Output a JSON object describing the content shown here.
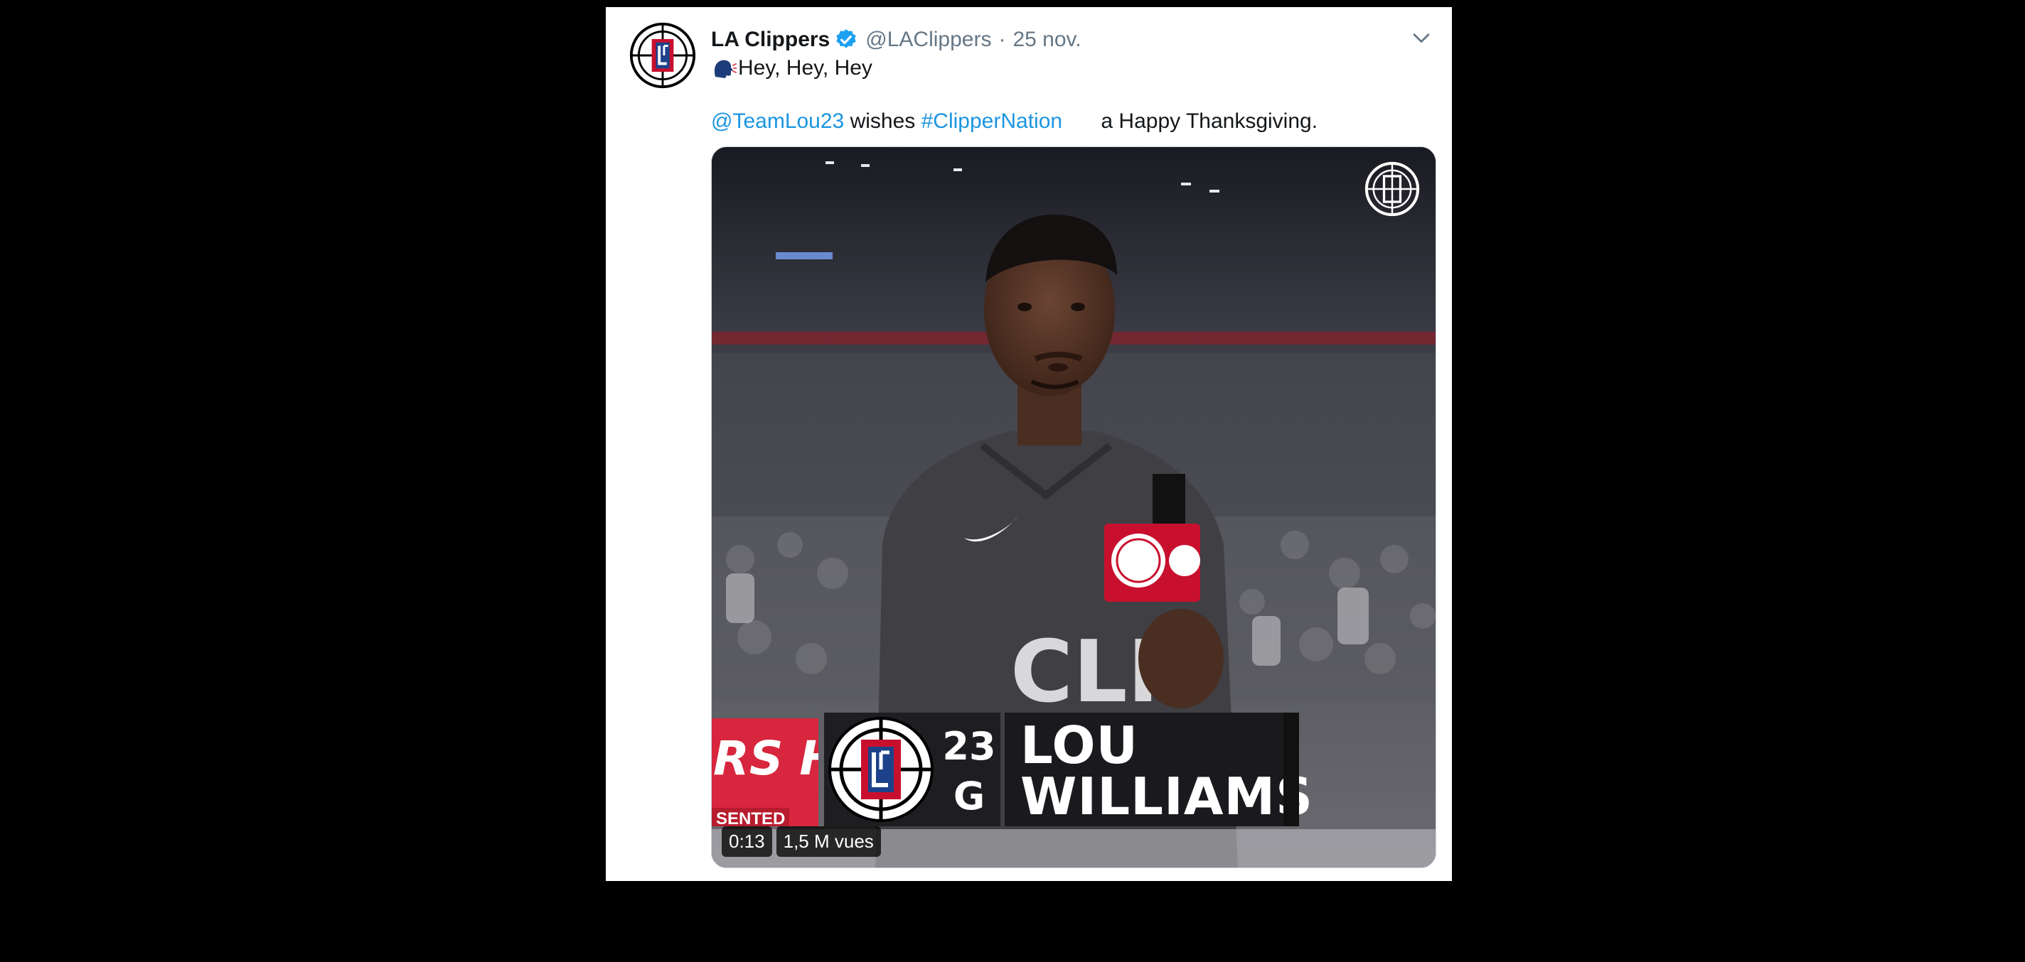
{
  "tweet": {
    "account_name": "LA Clippers",
    "handle": "@LAClippers",
    "separator": "·",
    "date": "25 nov.",
    "line1": "Hey, Hey, Hey",
    "mention": "@TeamLou23",
    "wishes": " wishes ",
    "hashtag": "#ClipperNation",
    "ending": " a Happy Thanksgiving.",
    "icons": {
      "avatar": "clippers-logo",
      "verified": "verified-badge-icon",
      "menu": "chevron-down-icon",
      "speaking": "speaking-head-icon",
      "hashtag_logo": "clippers-logo"
    }
  },
  "media": {
    "lower_third": {
      "number": "23",
      "position": "G",
      "first_name": "LOU",
      "last_name": "WILLIAMS",
      "red_banner_text": "RS H",
      "red_banner_sub": "SENTED"
    },
    "duration": "0:13",
    "views": "1,5 M vues"
  },
  "colors": {
    "link": "#1b95e0",
    "clippers_red": "#c8102e",
    "clippers_blue": "#1d428a",
    "verified": "#1da1f2"
  }
}
